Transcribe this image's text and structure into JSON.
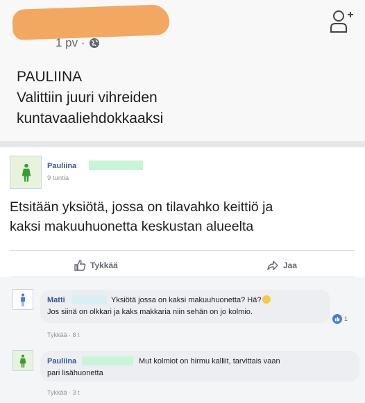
{
  "post1": {
    "meta": "1 pv ·",
    "lines": [
      "PAULIINA",
      "Valittiin juuri vihreiden",
      "kuntavaaliehdokkaaksi"
    ]
  },
  "post2": {
    "author": "Pauliina",
    "time": "9 tuntia",
    "lines": [
      "Etsitään yksiötä, jossa on tilavahko keittiö ja",
      "kaksi makuuhuonetta keskustan alueelta"
    ],
    "like_label": "Tykkää",
    "share_label": "Jaa"
  },
  "comments": [
    {
      "author": "Matti",
      "line1": "Yksiötä jossa on kaksi makuuhuonetta? Hä?",
      "line2": "Jos siinä on olkkari ja kaks makkaria niin sehän on jo kolmio.",
      "meta": "Tykkää · 8 t",
      "reactions": "1"
    },
    {
      "author": "Pauliina",
      "line1": "Mut kolmiot on hirmu kalliit, tarvittais vaan",
      "line2": "pari lisähuonetta",
      "meta": "Tykkää · 3 t"
    }
  ],
  "colors": {
    "accent": "#385898",
    "redaction_orange": "#f2a35a",
    "redaction_green": "#c8f5d8",
    "female_avatar_bg": "#e8f3de",
    "female_icon": "#3d9b35",
    "male_icon": "#4a7be0"
  },
  "icons": [
    "globe-icon",
    "add-friend-icon",
    "female-person-icon",
    "male-person-icon",
    "thumbs-up-icon",
    "share-arrow-icon",
    "like-reaction-icon",
    "smile-emoji-icon"
  ]
}
